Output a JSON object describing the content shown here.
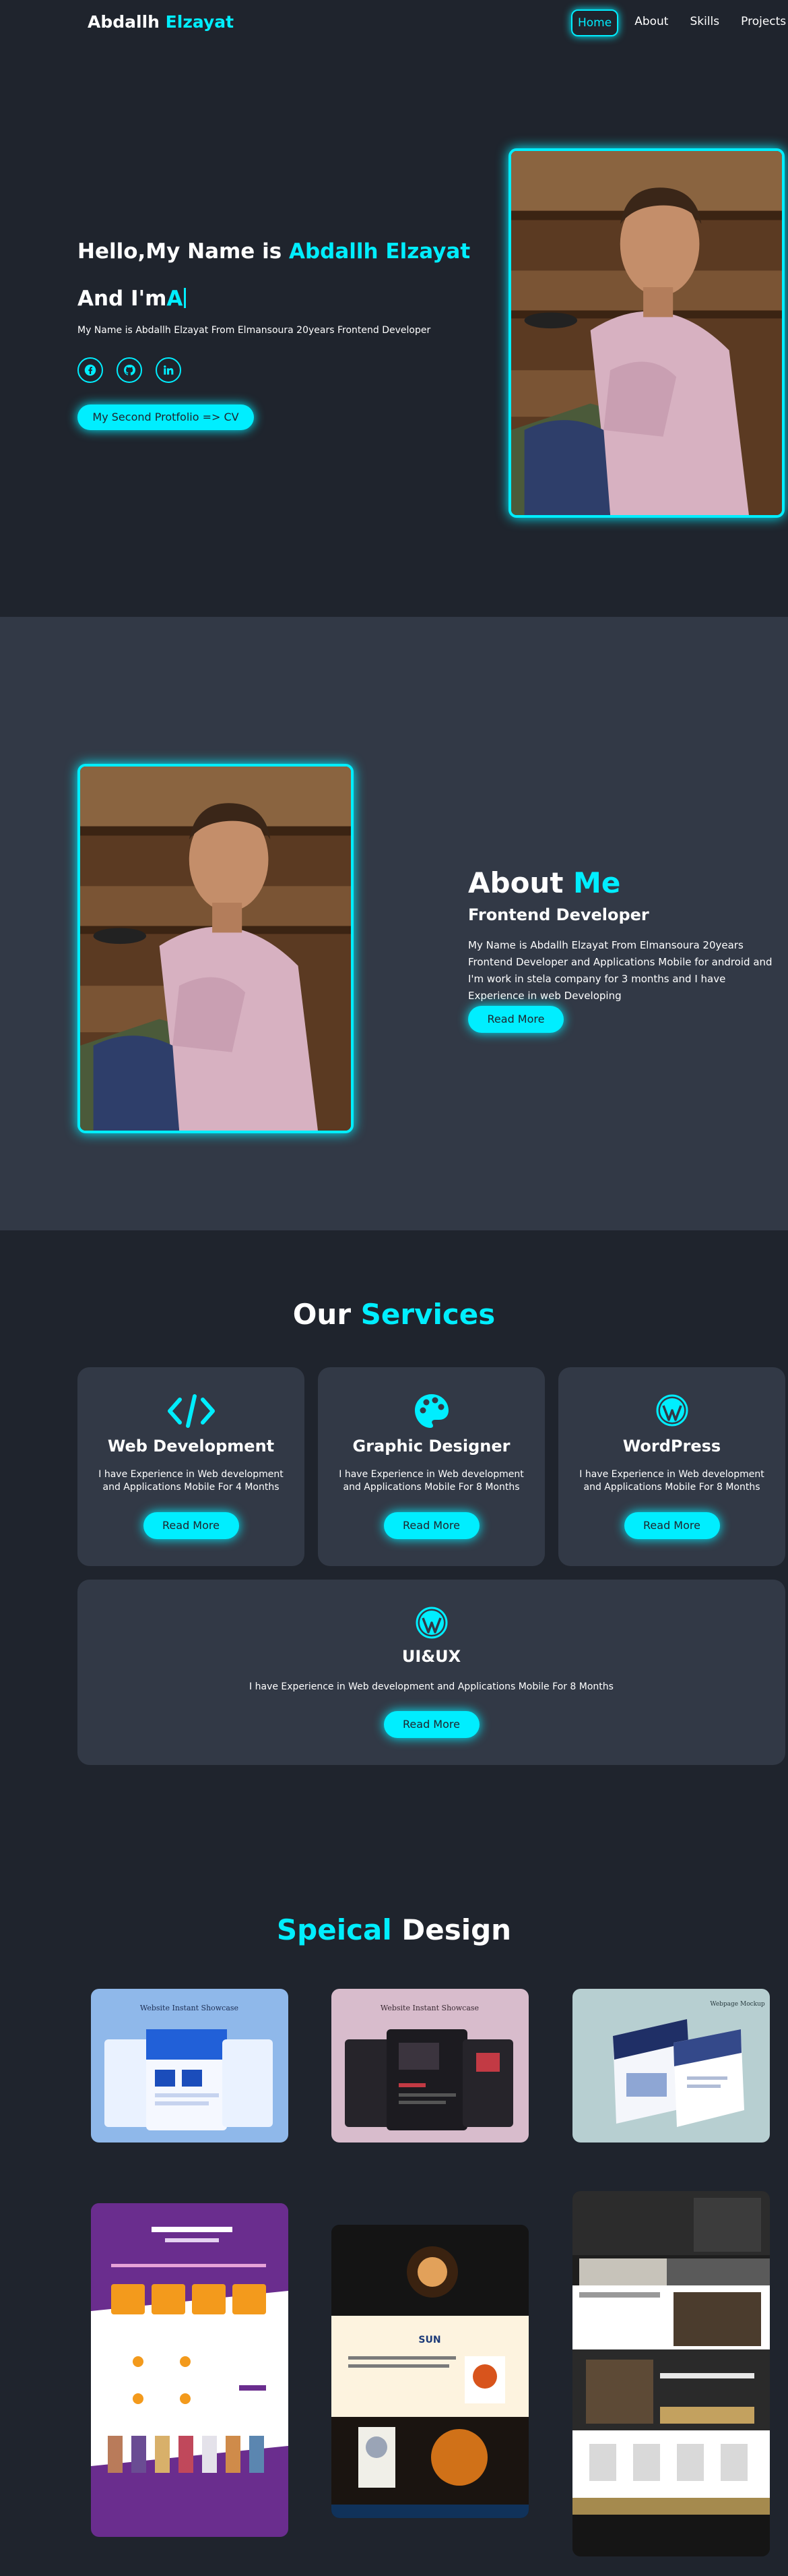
{
  "header": {
    "logo_first": "Abdallh",
    "logo_second": "Elzayat",
    "nav": [
      "Home",
      "About",
      "Skills",
      "Projects"
    ]
  },
  "hero": {
    "greeting": "Hello,My Name is ",
    "name": "Abdallh Elzayat",
    "role_prefix": "And I'm",
    "role_typed": "A",
    "intro": "My Name is Abdallh Elzayat From Elmansoura 20years Frontend Developer",
    "socials": [
      "facebook-icon",
      "github-icon",
      "linkedin-icon"
    ],
    "cv_button": "My Second Protfolio => CV"
  },
  "about": {
    "title_first": "About",
    "title_second": "Me",
    "subtitle": "Frontend Developer",
    "text": "My Name is Abdallh Elzayat From Elmansoura 20years Frontend Developer and Applications Mobile for android and I'm work in stela company for 3 months and I have Experience in web Developing",
    "button": "Read More"
  },
  "services": {
    "title_first": "Our",
    "title_second": "Services",
    "items": [
      {
        "icon": "code-icon",
        "title": "Web Development",
        "text": "I have Experience in Web development and Applications Mobile For 4 Months",
        "button": "Read More"
      },
      {
        "icon": "palette-icon",
        "title": "Graphic Designer",
        "text": "I have Experience in Web development and Applications Mobile For 8 Months",
        "button": "Read More"
      },
      {
        "icon": "wordpress-icon",
        "title": "WordPress",
        "text": "I have Experience in Web development and Applications Mobile For 8 Months",
        "button": "Read More"
      },
      {
        "icon": "wordpress-icon",
        "title": "UI&UX",
        "text": "I have Experience in Web development and Applications Mobile For 8 Months",
        "button": "Read More"
      }
    ]
  },
  "design": {
    "title_first": "Speical",
    "title_second": "Design",
    "thumbnails": [
      {
        "caption": "Website Instant Showcase"
      },
      {
        "caption": "Website Instant Showcase"
      },
      {
        "caption": "Webpage Mockup"
      },
      {
        "caption": ""
      },
      {
        "caption": "SUN"
      },
      {
        "caption": ""
      }
    ]
  },
  "colors": {
    "accent": "#00eeff",
    "bg": "#1f242d",
    "panel": "#323946"
  }
}
